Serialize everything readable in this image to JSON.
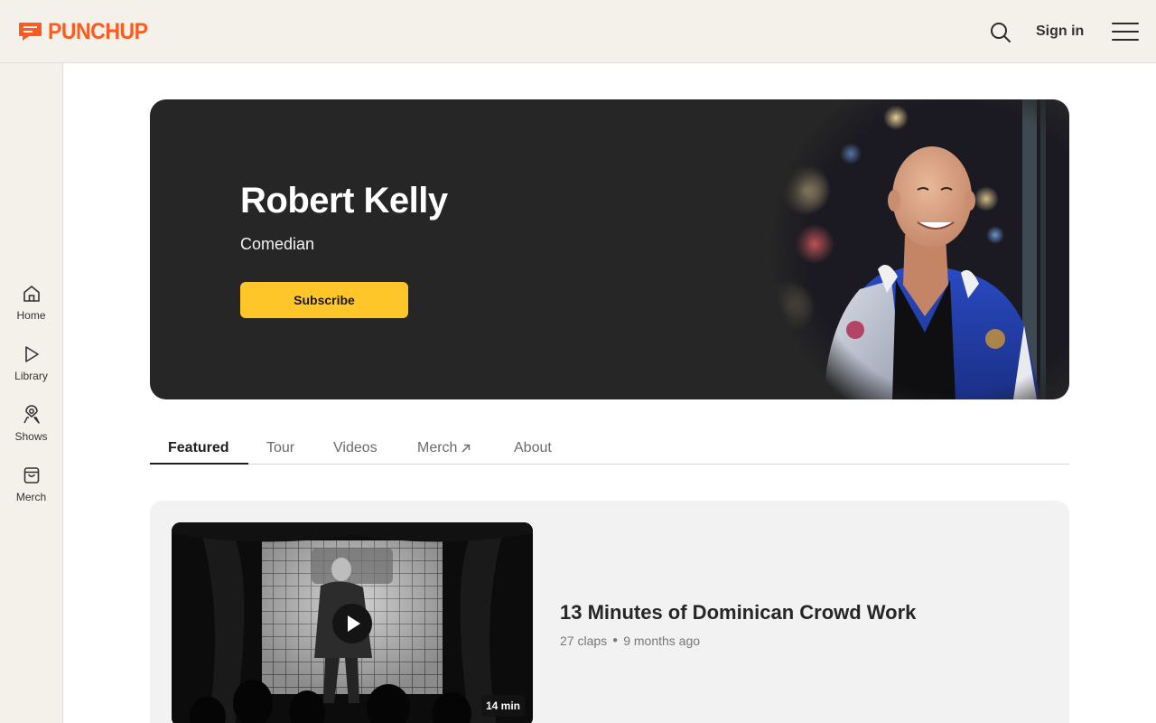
{
  "header": {
    "logo_text": "PUNCHUP",
    "brand_color": "#ff5a1f",
    "sign_in_label": "Sign in",
    "search_icon": "search-icon",
    "menu_icon": "hamburger-menu-icon"
  },
  "sidebar": {
    "items": [
      {
        "label": "Home",
        "icon": "home-icon"
      },
      {
        "label": "Library",
        "icon": "play-icon"
      },
      {
        "label": "Shows",
        "icon": "map-pin-icon"
      },
      {
        "label": "Merch",
        "icon": "shopping-bag-icon"
      }
    ]
  },
  "hero": {
    "name": "Robert Kelly",
    "role": "Comedian",
    "subscribe_label": "Subscribe",
    "subscribe_color": "#ffc629",
    "background_color": "#262626"
  },
  "tabs": [
    {
      "label": "Featured",
      "active": true
    },
    {
      "label": "Tour",
      "active": false
    },
    {
      "label": "Videos",
      "active": false
    },
    {
      "label": "Merch",
      "active": false,
      "external": true
    },
    {
      "label": "About",
      "active": false
    }
  ],
  "featured_video": {
    "title": "13 Minutes of Dominican Crowd Work",
    "claps": "27 claps",
    "age": "9 months ago",
    "duration": "14 min"
  }
}
